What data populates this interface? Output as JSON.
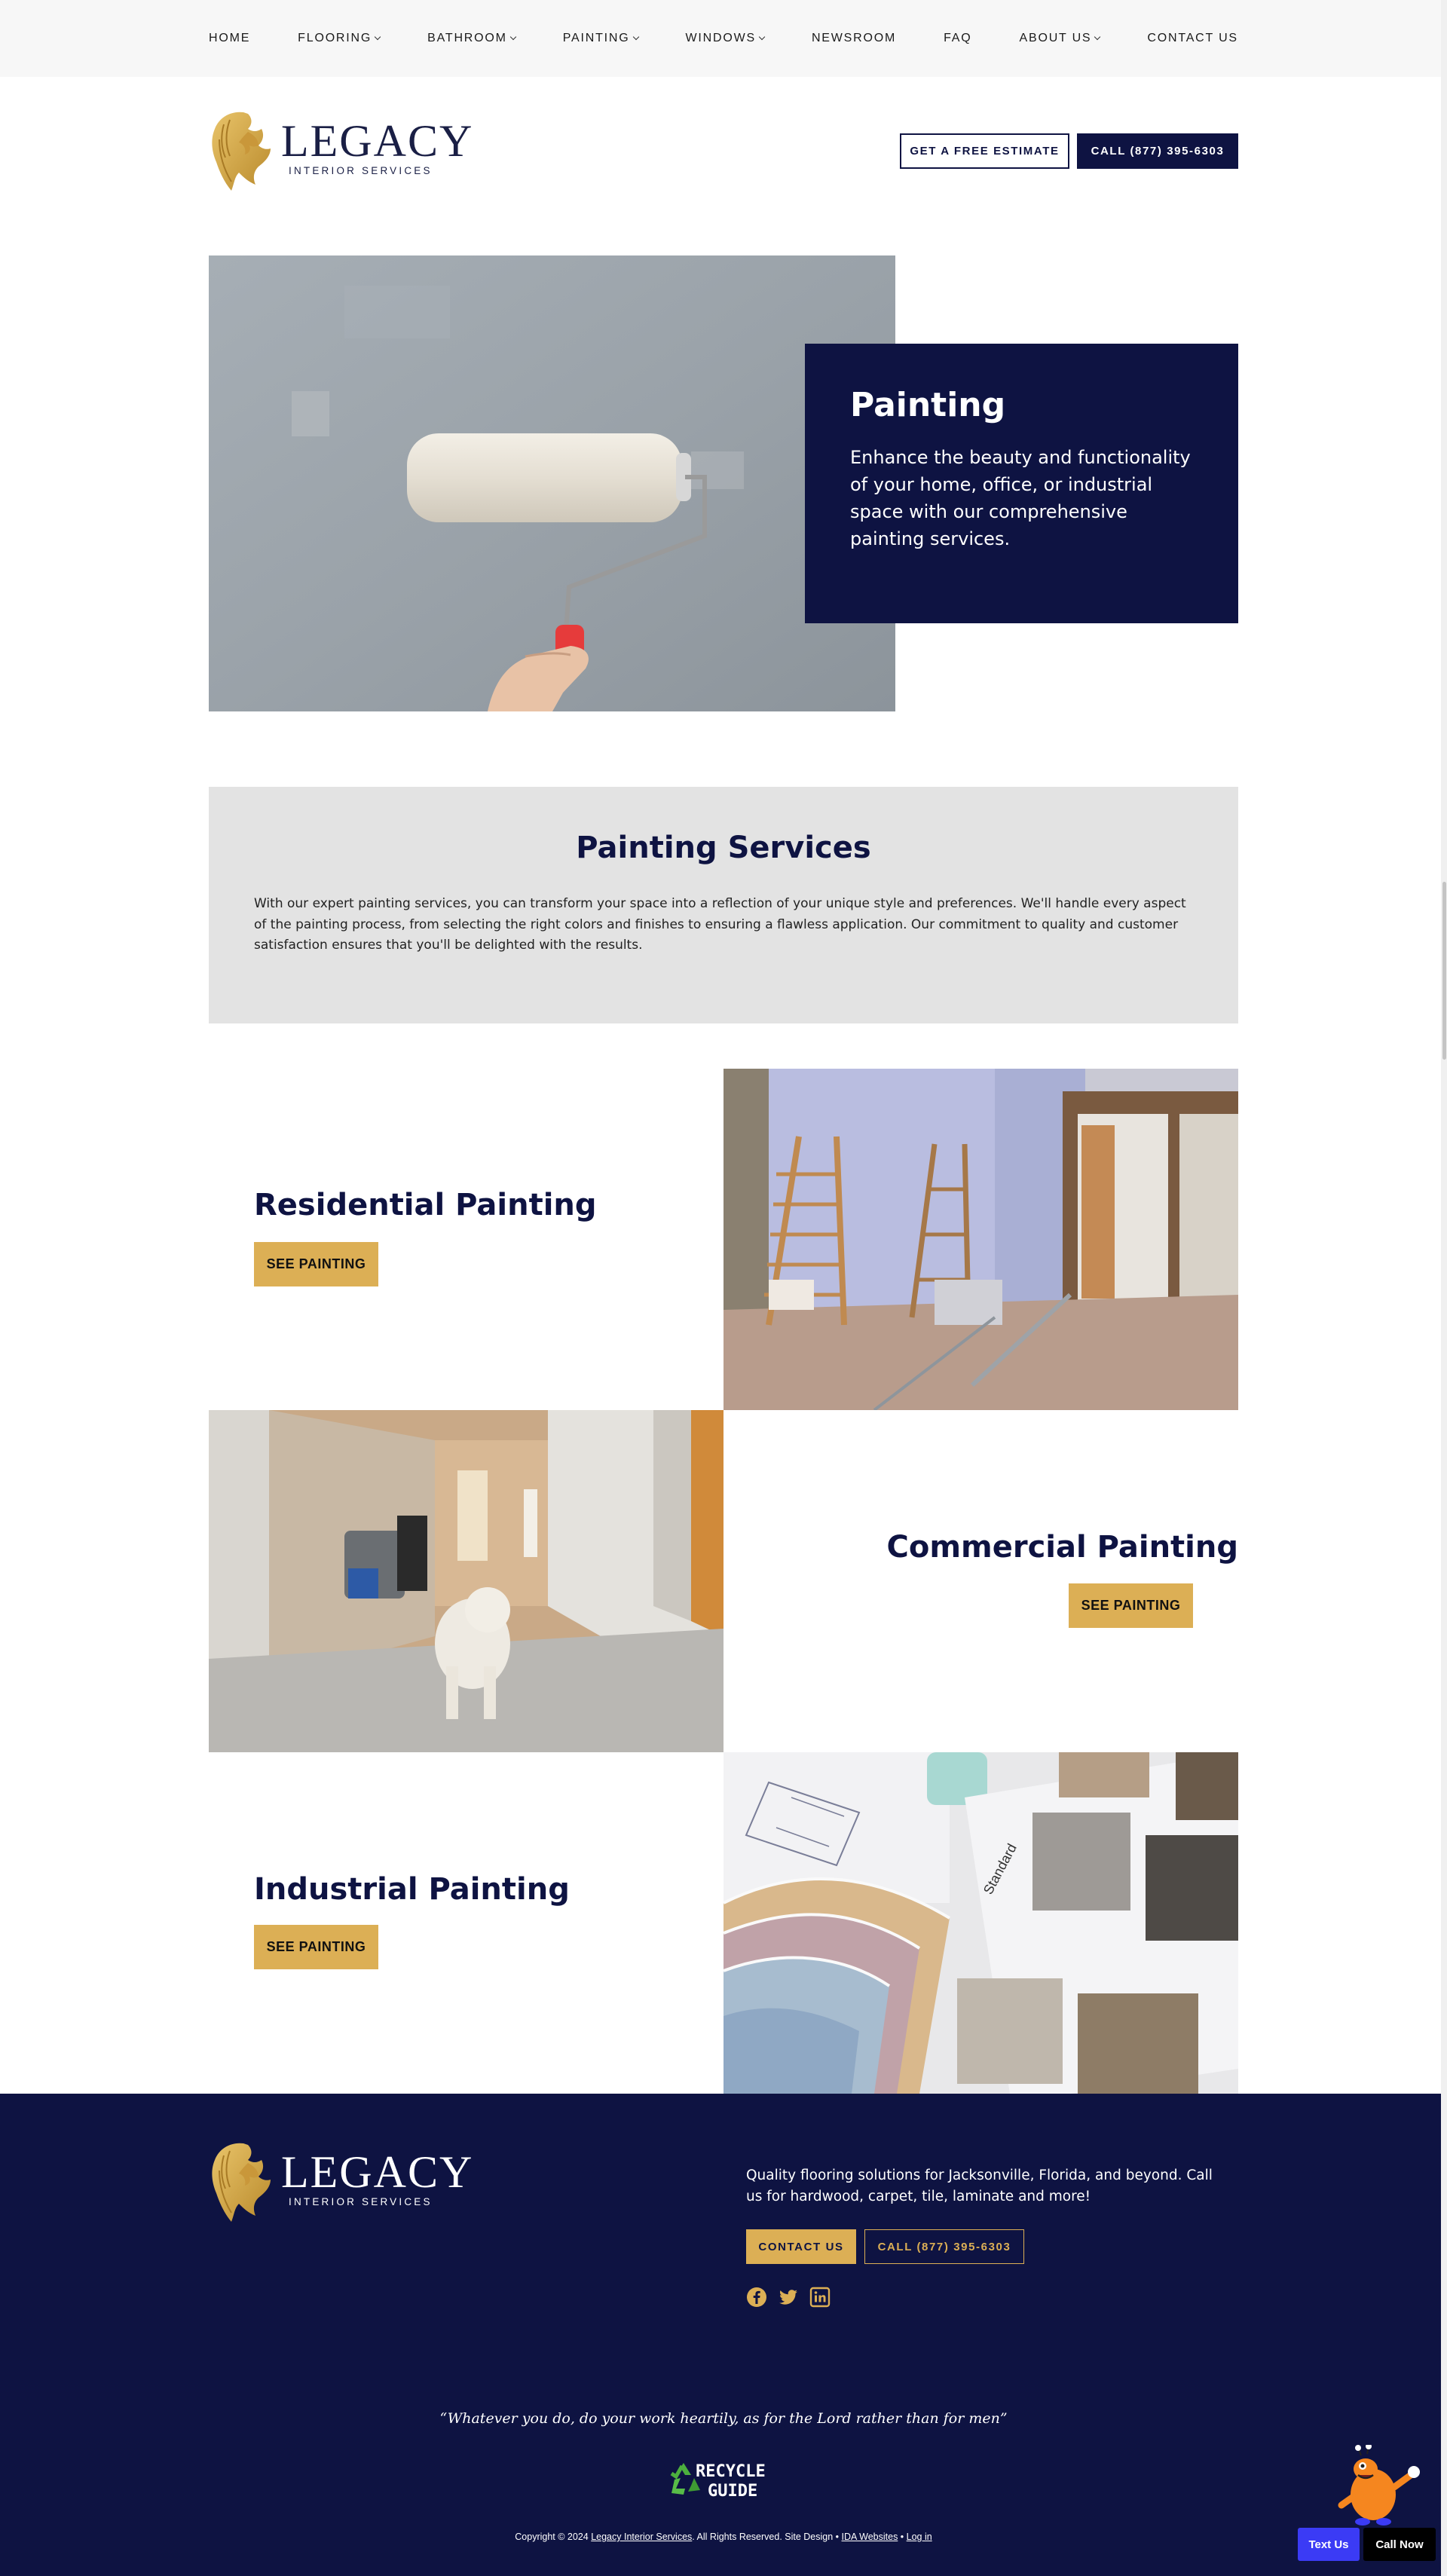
{
  "nav": {
    "items": [
      {
        "label": "HOME",
        "dropdown": false
      },
      {
        "label": "FLOORING",
        "dropdown": true
      },
      {
        "label": "BATHROOM",
        "dropdown": true
      },
      {
        "label": "PAINTING",
        "dropdown": true
      },
      {
        "label": "WINDOWS",
        "dropdown": true
      },
      {
        "label": "NEWSROOM",
        "dropdown": false
      },
      {
        "label": "FAQ",
        "dropdown": false
      },
      {
        "label": "ABOUT US",
        "dropdown": true
      },
      {
        "label": "CONTACT US",
        "dropdown": false
      }
    ]
  },
  "header": {
    "logo_main": "LEGACY",
    "logo_sub": "INTERIOR SERVICES",
    "estimate_label": "GET A FREE ESTIMATE",
    "call_label": "CALL (877) 395-6303"
  },
  "hero": {
    "title": "Painting",
    "text": "Enhance the beauty and functionality of your home, office, or industrial space with our comprehensive painting services."
  },
  "services": {
    "title": "Painting Services",
    "text": "With our expert painting services, you can transform your space into a reflection of your unique style and preferences. We'll handle every aspect of the painting process, from selecting the right colors and finishes to ensuring a flawless application. Our commitment to quality and customer satisfaction ensures that you'll be delighted with the results."
  },
  "rows": [
    {
      "title": "Residential Painting",
      "button": "SEE PAINTING"
    },
    {
      "title": "Commercial Painting",
      "button": "SEE PAINTING"
    },
    {
      "title": "Industrial Painting",
      "button": "SEE PAINTING"
    }
  ],
  "footer": {
    "logo_main": "LEGACY",
    "logo_sub": "INTERIOR SERVICES",
    "text": "Quality flooring solutions for Jacksonville, Florida, and beyond. Call us for hardwood, carpet, tile, laminate and more!",
    "contact_label": "CONTACT US",
    "call_label": "CALL (877) 395-6303",
    "social": [
      "facebook-icon",
      "twitter-icon",
      "linkedin-icon"
    ],
    "quote": "“Whatever you do, do your work heartily, as for the Lord rather than for men”",
    "recycle_line1": "RECYCLE",
    "recycle_line2": "GUIDE",
    "copyright_pre": "Copyright © 2024 ",
    "copyright_company": "Legacy Interior Services",
    "copyright_mid": ". All Rights Reserved. Site Design • ",
    "copyright_designer": "IDA Websites",
    "copyright_sep": " • ",
    "copyright_login": "Log in"
  },
  "floating": {
    "text_us": "Text Us",
    "call_now": "Call Now"
  },
  "colors": {
    "navy": "#0e1342",
    "gold": "#dcaf55",
    "light_gray": "#e3e3e3"
  }
}
